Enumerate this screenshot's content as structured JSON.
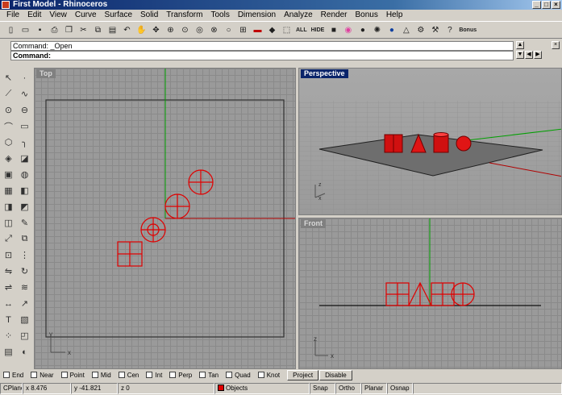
{
  "window": {
    "title": "First Model - Rhinoceros",
    "buttons": [
      "_",
      "□",
      "×"
    ]
  },
  "menu": [
    "File",
    "Edit",
    "View",
    "Curve",
    "Surface",
    "Solid",
    "Transform",
    "Tools",
    "Dimension",
    "Analyze",
    "Render",
    "Bonus",
    "Help"
  ],
  "toolbar": {
    "all_label": "ALL",
    "hide_label": "HIDE",
    "bonus_label": "Bonus"
  },
  "command": {
    "history": "Command: _Open",
    "prompt": "Command:"
  },
  "viewports": {
    "top": "Top",
    "perspective": "Perspective",
    "front": "Front"
  },
  "axis_labels": {
    "x": "x",
    "y": "y",
    "z": "z"
  },
  "osnap": {
    "items": [
      "End",
      "Near",
      "Point",
      "Mid",
      "Cen",
      "Int",
      "Perp",
      "Tan",
      "Quad",
      "Knot"
    ],
    "project": "Project",
    "disable": "Disable"
  },
  "status": {
    "cplane": "CPlane",
    "x": "x 8.476",
    "y": "y -41.821",
    "z": "z 0",
    "layer": "Objects",
    "snap": "Snap",
    "ortho": "Ortho",
    "planar": "Planar",
    "osnap": "Osnap"
  },
  "colors": {
    "object": "#e00000",
    "x_axis": "#b00000",
    "y_axis": "#00a000",
    "active_label": "#0a246a"
  }
}
